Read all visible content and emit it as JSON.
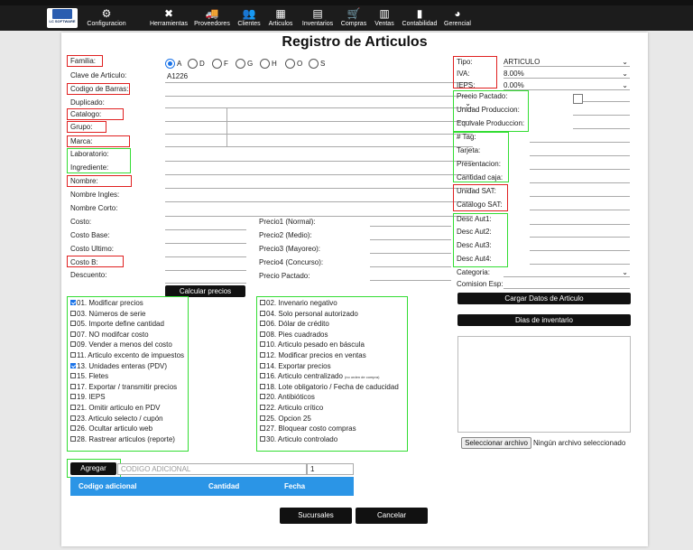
{
  "nav": {
    "brand": "LC SOFTWARE",
    "items": [
      {
        "label": "Configuracion",
        "icon": "gear-icon",
        "glyph": "⚙"
      },
      {
        "label": "Herramientas",
        "icon": "tools-icon",
        "glyph": "✖"
      },
      {
        "label": "Proveedores",
        "icon": "truck-icon",
        "glyph": "🚚"
      },
      {
        "label": "Clientes",
        "icon": "users-icon",
        "glyph": "👥"
      },
      {
        "label": "Articulos",
        "icon": "boxes-icon",
        "glyph": "▦"
      },
      {
        "label": "Inventarios",
        "icon": "warehouse-icon",
        "glyph": "▤"
      },
      {
        "label": "Compras",
        "icon": "cart-icon",
        "glyph": "🛒"
      },
      {
        "label": "Ventas",
        "icon": "register-icon",
        "glyph": "▥"
      },
      {
        "label": "Contabilidad",
        "icon": "ledger-icon",
        "glyph": "▮"
      },
      {
        "label": "Gerencial",
        "icon": "pie-chart-icon",
        "glyph": "◕"
      }
    ]
  },
  "form": {
    "title": "Registro de Articulos",
    "left_labels": [
      "Familia:",
      "Clave de Articulo:",
      "Codigo de Barras:",
      "Duplicado:",
      "Catalogo:",
      "Grupo:",
      "Marca:",
      "Laboratorio:",
      "Ingrediente:",
      "Nombre:",
      "Nombre Ingles:",
      "Nombre Corto:",
      "Costo:",
      "Costo Base:",
      "Costo Ultimo:",
      "Costo B:",
      "Descuento:"
    ],
    "familia_options": [
      "A",
      "D",
      "F",
      "G",
      "H",
      "O",
      "S"
    ],
    "familia_selected": "A",
    "clave_articulo": "A1226",
    "precio_labels": [
      "Precio1 (Normal):",
      "Precio2 (Medio):",
      "Precio3 (Mayoreo):",
      "Precio4 (Concurso):",
      "Precio Pactado:"
    ],
    "calcular_button": "Calcular precios",
    "right": {
      "tipo_label": "Tipo:",
      "tipo_value": "ARTICULO",
      "iva_label": "IVA:",
      "iva_value": "8.00%",
      "ieps_label": "IEPS:",
      "ieps_value": "0.00%",
      "group2": [
        "Precio Pactado:",
        "Unidad Produccion:",
        "Equivale Produccion:"
      ],
      "group3": [
        "# Tag:",
        "Tarjeta:",
        "Presentacion:",
        "Cantidad caja:"
      ],
      "group4": [
        "Unidad SAT:",
        "Catalogo SAT:"
      ],
      "group5": [
        "Desc Aut1:",
        "Desc Aut2:",
        "Desc Aut3:",
        "Desc Aut4:"
      ],
      "categoria_label": "Categoria:",
      "comision_label": "Comision Esp:",
      "cargar_button": "Cargar Datos de Articulo",
      "dias_button": "Dias de inventario",
      "file_button": "Seleccionar archivo",
      "file_status": "Ningún archivo seleccionado"
    },
    "checks_left": [
      {
        "label": "01. Modificar precios",
        "checked": true
      },
      {
        "label": "03. Números de serie",
        "checked": false
      },
      {
        "label": "05. Importe define cantidad",
        "checked": false
      },
      {
        "label": "07. NO modifcar costo",
        "checked": false
      },
      {
        "label": "09. Vender a menos del costo",
        "checked": false
      },
      {
        "label": "11. Articulo excento de impuestos",
        "checked": false
      },
      {
        "label": "13. Unidades enteras (PDV)",
        "checked": true
      },
      {
        "label": "15. Fletes",
        "checked": false
      },
      {
        "label": "17. Exportar / transmitir precios",
        "checked": false
      },
      {
        "label": "19. IEPS",
        "checked": false
      },
      {
        "label": "21. Omitir articulo en PDV",
        "checked": false
      },
      {
        "label": "23. Articulo selecto / cupón",
        "checked": false
      },
      {
        "label": "26. Ocultar articulo web",
        "checked": false
      },
      {
        "label": "28. Rastrear articulos (reporte)",
        "checked": false
      }
    ],
    "checks_right": [
      {
        "label": "02. Invenario negativo",
        "checked": false
      },
      {
        "label": "04. Solo personal autorizado",
        "checked": false
      },
      {
        "label": "06. Dólar de crédito",
        "checked": false
      },
      {
        "label": "08. Pies cuadrados",
        "checked": false
      },
      {
        "label": "10. Articulo pesado en báscula",
        "checked": false
      },
      {
        "label": "12. Modificar precios en ventas",
        "checked": false
      },
      {
        "label": "14. Exportar precios",
        "checked": false
      },
      {
        "label": "16. Articulo centralizado",
        "checked": false,
        "note": "(no orden de compra)"
      },
      {
        "label": "18. Lote obligatorio / Fecha de caducidad",
        "checked": false
      },
      {
        "label": "20. Antibióticos",
        "checked": false
      },
      {
        "label": "22. Articulo crítico",
        "checked": false
      },
      {
        "label": "25. Opcion 25",
        "checked": false
      },
      {
        "label": "27. Bloquear costo compras",
        "checked": false
      },
      {
        "label": "30. Articulo controlado",
        "checked": false
      }
    ],
    "codigo": {
      "agregar_button": "Agregar",
      "placeholder": "CODIGO ADICIONAL",
      "cantidad": "1",
      "columns": [
        "Codigo adicional",
        "Cantidad",
        "Fecha"
      ]
    },
    "bottom": {
      "sucursales": "Sucursales",
      "cancelar": "Cancelar"
    }
  }
}
